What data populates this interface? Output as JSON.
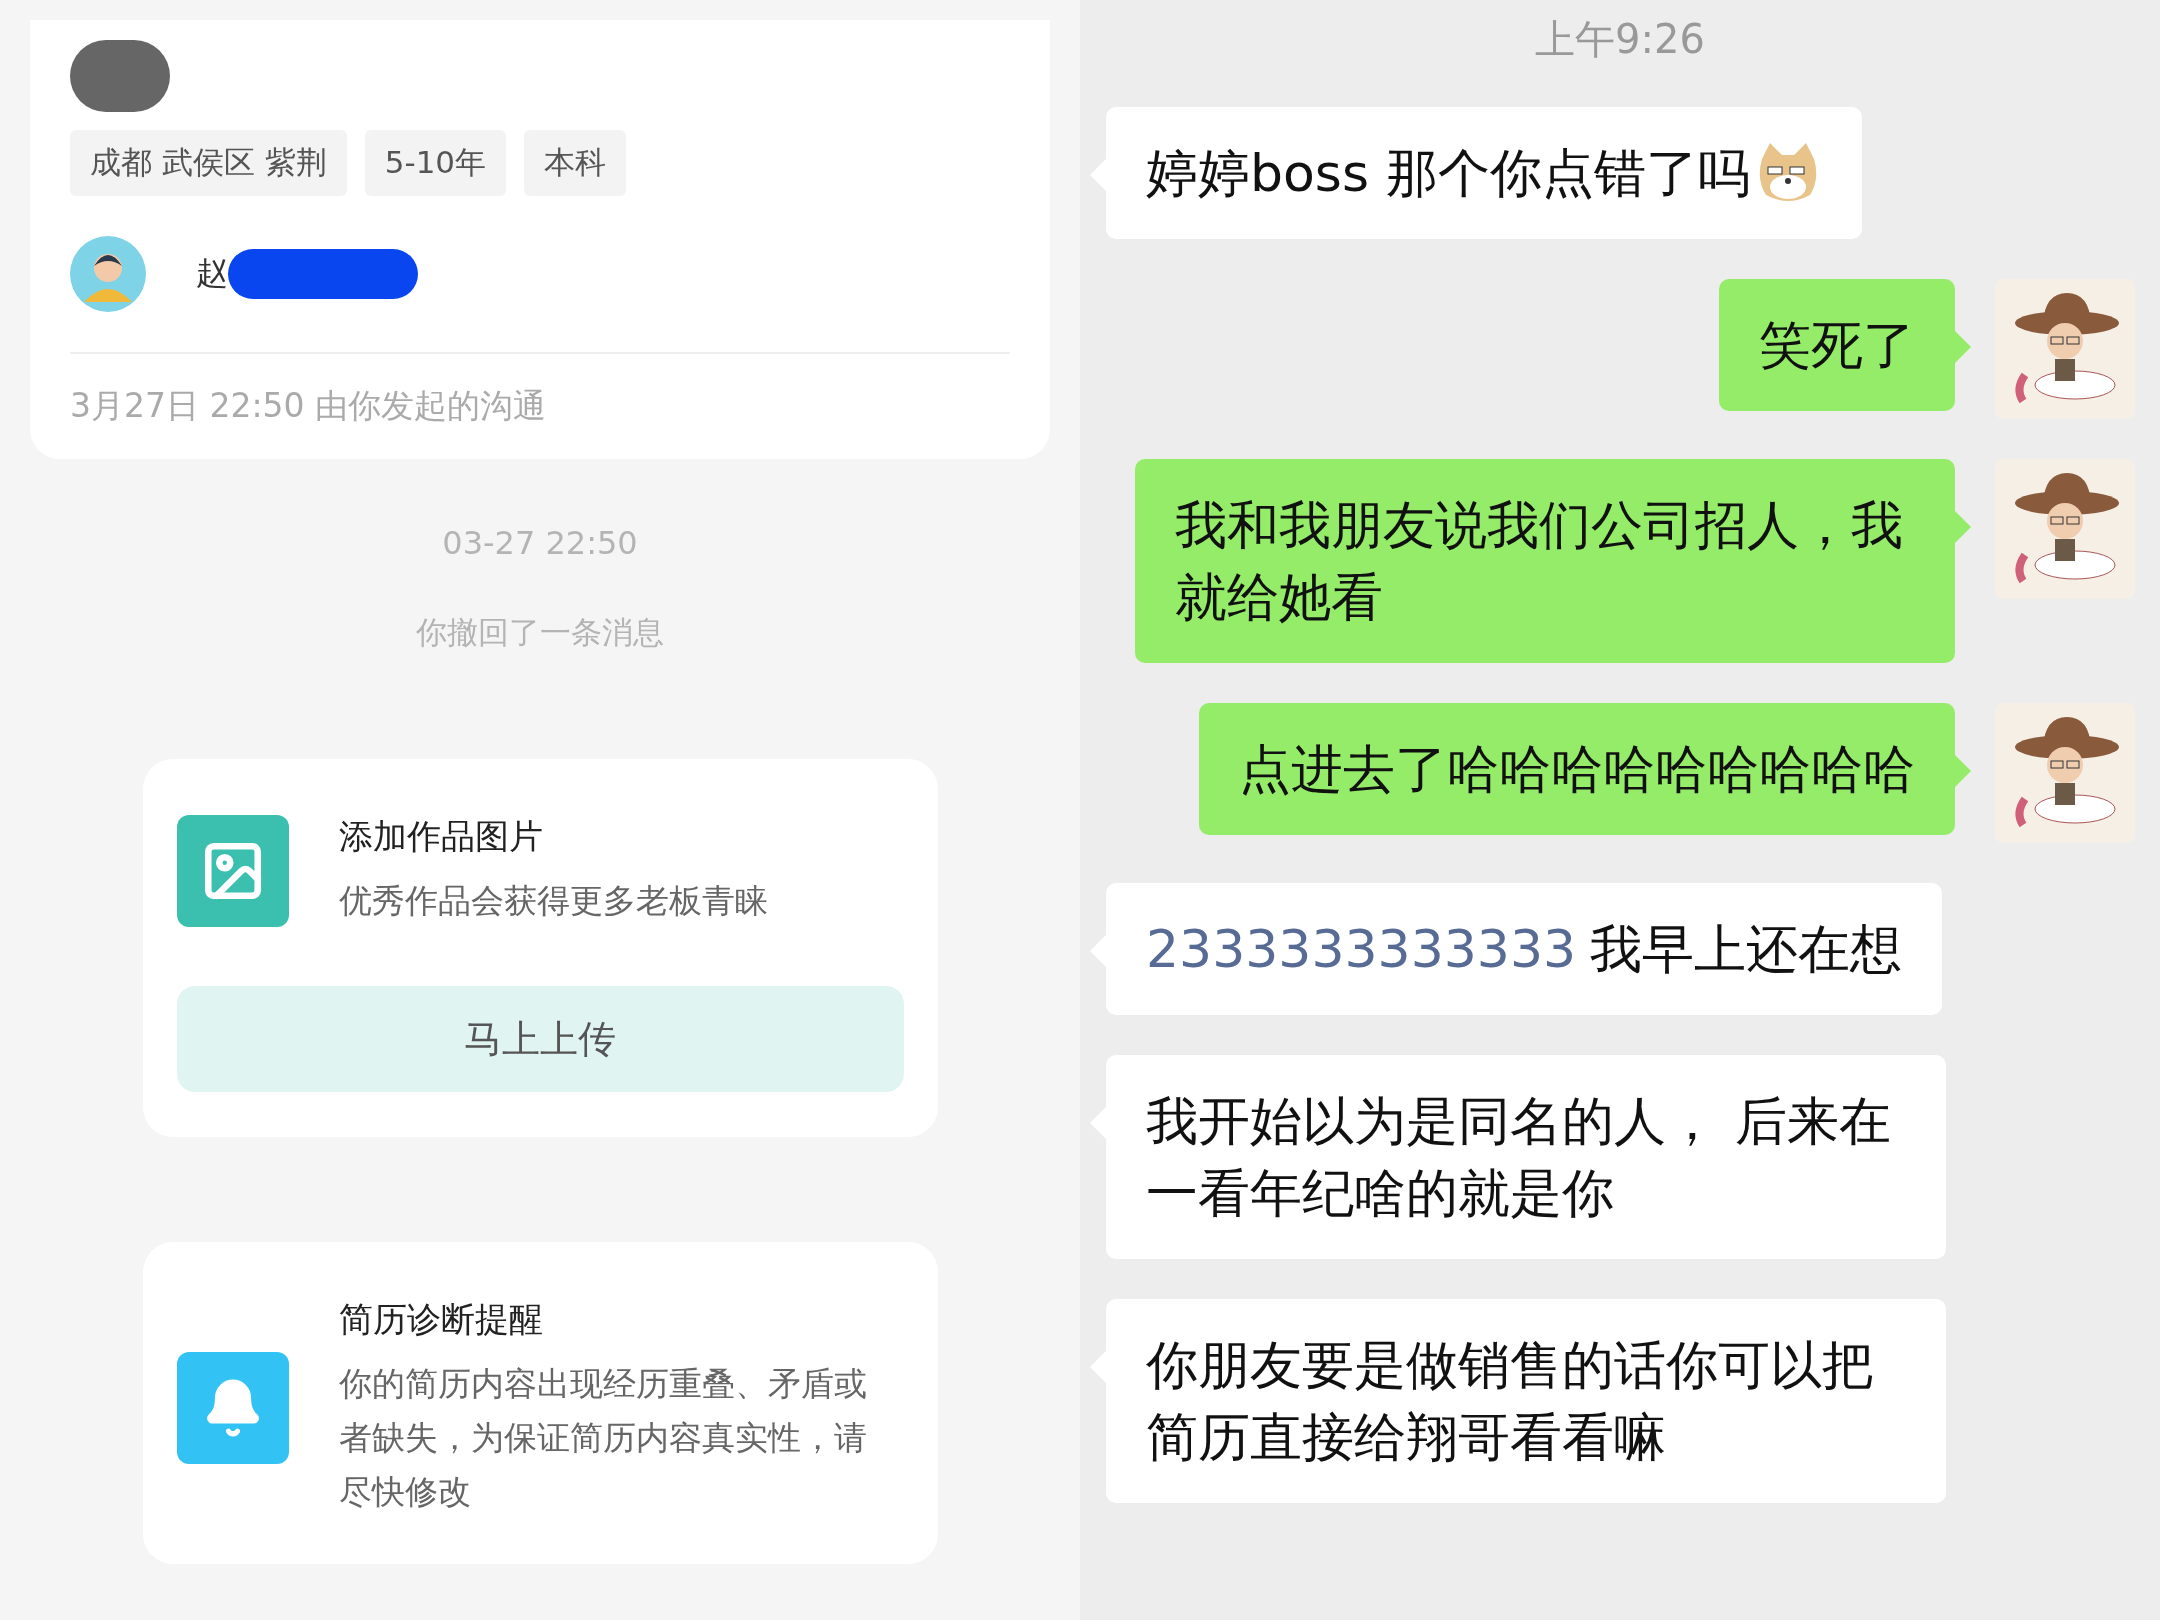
{
  "left_panel": {
    "profile_card": {
      "tags": [
        "成都 武侯区 紫荆",
        "5-10年",
        "本科"
      ],
      "contact_name": "赵",
      "footer": "3月27日 22:50 由你发起的沟通"
    },
    "timestamp": "03-27 22:50",
    "system_notice": "你撤回了一条消息",
    "cards": [
      {
        "kind": "portfolio",
        "title": "添加作品图片",
        "description": "优秀作品会获得更多老板青睐",
        "button": "马上上传"
      },
      {
        "kind": "alert",
        "title": "简历诊断提醒",
        "description": "你的简历内容出现经历重叠、矛盾或者缺失，为保证简历内容真实性，请尽快修改"
      }
    ]
  },
  "right_panel": {
    "time": "上午9:26",
    "messages": [
      {
        "kind": "received",
        "text": "婷婷boss 那个你点错了吗",
        "emoji": true
      },
      {
        "kind": "sent",
        "text": "笑死了"
      },
      {
        "kind": "sent",
        "text": "我和我朋友说我们公司招人，我就给她看"
      },
      {
        "kind": "sent",
        "text": "点进去了哈哈哈哈哈哈哈哈哈"
      },
      {
        "kind": "received",
        "number": "2333333333333",
        "text": "我早上还在想"
      },
      {
        "kind": "received",
        "text": "我开始以为是同名的人， 后来在一看年纪啥的就是你"
      },
      {
        "kind": "received",
        "text": "你朋友要是做销售的话你可以把简历直接给翔哥看看嘛"
      }
    ]
  }
}
